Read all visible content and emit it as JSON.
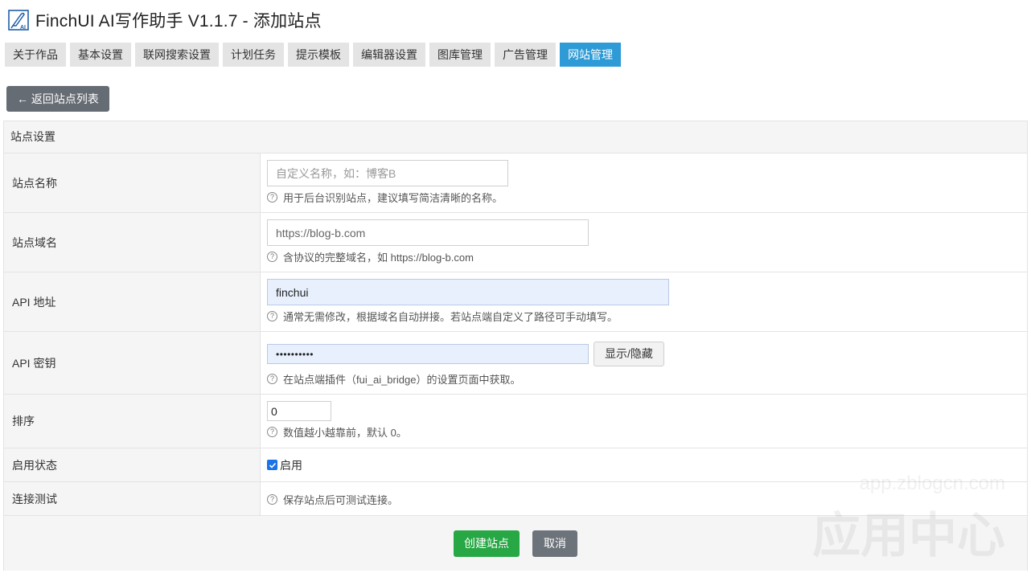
{
  "header": {
    "title": "FinchUI AI写作助手 V1.1.7 - 添加站点",
    "logo_icon": "pen-ai-logo"
  },
  "tabs": [
    {
      "label": "关于作品",
      "active": false
    },
    {
      "label": "基本设置",
      "active": false
    },
    {
      "label": "联网搜索设置",
      "active": false
    },
    {
      "label": "计划任务",
      "active": false
    },
    {
      "label": "提示模板",
      "active": false
    },
    {
      "label": "编辑器设置",
      "active": false
    },
    {
      "label": "图库管理",
      "active": false
    },
    {
      "label": "广告管理",
      "active": false
    },
    {
      "label": "网站管理",
      "active": true
    }
  ],
  "back_button": {
    "label": "← 返回站点列表"
  },
  "panel": {
    "heading": "站点设置"
  },
  "form": {
    "site_name": {
      "label": "站点名称",
      "placeholder": "自定义名称，如：博客B",
      "hint": "用于后台识别站点，建议填写简洁清晰的名称。"
    },
    "site_domain": {
      "label": "站点域名",
      "placeholder": "https://blog-b.com",
      "hint": "含协议的完整域名，如 https://blog-b.com"
    },
    "api_url": {
      "label": "API 地址",
      "value": "finchui",
      "hint": "通常无需修改，根据域名自动拼接。若站点端自定义了路径可手动填写。"
    },
    "api_key": {
      "label": "API 密钥",
      "value": "••••••••••",
      "toggle_label": "显示/隐藏",
      "hint": "在站点端插件（fui_ai_bridge）的设置页面中获取。"
    },
    "sort": {
      "label": "排序",
      "value": "0",
      "hint": "数值越小越靠前，默认 0。"
    },
    "status": {
      "label": "启用状态",
      "checkbox_label": "启用",
      "checked": true
    },
    "connection_test": {
      "label": "连接测试",
      "hint": "保存站点后可测试连接。"
    }
  },
  "actions": {
    "create_label": "创建站点",
    "cancel_label": "取消"
  },
  "watermark": {
    "url": "app.zblogcn.com",
    "text": "应用中心"
  },
  "colors": {
    "tab_active": "#2e9bd6",
    "primary_button": "#28a745",
    "secondary_button": "#6c737a",
    "input_filled": "#e8f0fe"
  }
}
